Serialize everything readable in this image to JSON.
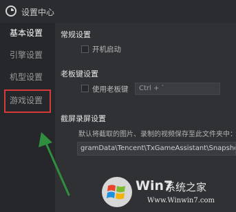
{
  "window": {
    "title": "设置中心"
  },
  "sidebar": {
    "items": [
      {
        "label": "基本设置"
      },
      {
        "label": "引擎设置"
      },
      {
        "label": "机型设置"
      },
      {
        "label": "游戏设置"
      }
    ]
  },
  "general": {
    "heading": "常规设置",
    "autostart_label": "开机启动"
  },
  "boss_key": {
    "heading": "老板键设置",
    "enable_label": "使用老板键",
    "hotkey_value": "Ctrl + `"
  },
  "screenshot": {
    "heading": "截屏录屏设置",
    "description": "默认将截取的图片、录制的视频保存至此文件夹中：",
    "path_value": "gramData\\Tencent\\TxGameAssistant\\Snapshot"
  },
  "watermark": {
    "brand_main": "Win7",
    "brand_cn": "系统之家",
    "url": "Www.Winwin7.com"
  },
  "colors": {
    "highlight_box": "#d83a3a",
    "arrow": "#2f8f3f"
  }
}
